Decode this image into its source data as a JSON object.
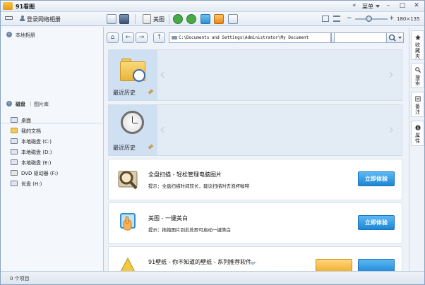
{
  "app": {
    "title": "91看图",
    "collapse_glyph": "«",
    "menu_label": "菜单",
    "window_controls": {
      "minimize": "–",
      "maximize": "□",
      "close": "✕"
    }
  },
  "toolbar": {
    "login_label": "登录网络相册",
    "beauty_label": "美图",
    "icons": [
      "usb-icon",
      "user-icon",
      "slideshow-icon",
      "screenshot-icon",
      "edit-icon",
      "rotate-left-icon",
      "rotate-right-icon",
      "delete-icon",
      "folder-icon",
      "chat-icon",
      "grid-view-icon",
      "list-view-icon"
    ],
    "zoom": {
      "minus": "−",
      "plus": "+",
      "value": "180×135",
      "level_fraction": 0.43
    }
  },
  "left_panel": {
    "album_header": "本地相册",
    "disk_header": "磁盘",
    "gallery_header": "图片库",
    "items": [
      {
        "label": "桌面",
        "icon": "desktop-icon"
      },
      {
        "label": "我的文档",
        "icon": "documents-icon"
      },
      {
        "label": "本地磁盘 (C:)",
        "icon": "disk-icon"
      },
      {
        "label": "本地磁盘 (D:)",
        "icon": "disk-icon"
      },
      {
        "label": "本地磁盘 (E:)",
        "icon": "disk-icon"
      },
      {
        "label": "DVD 驱动器 (F:)",
        "icon": "dvd-icon"
      },
      {
        "label": "优盘 (H:)",
        "icon": "usb-drive-icon"
      }
    ]
  },
  "address": {
    "home": "⌂",
    "back": "←",
    "forward": "→",
    "up": "↑",
    "path": "C:\\Documents and Settings\\Administrator\\My Document",
    "search_placeholder": ""
  },
  "content": {
    "history_cards": [
      {
        "label": "最近历史"
      },
      {
        "label": "最近历史"
      }
    ],
    "features": [
      {
        "title": "全盘扫描 - 轻松管理电脑图片",
        "tip": "提示：全盘扫描时间较长，建议扫描时去泡杯咖啡",
        "button": "立即体验"
      },
      {
        "title": "美图 - 一键美白",
        "tip": "提示：拖拽图片到此处即可启动一键美白",
        "button": "立即体验"
      },
      {
        "title": "91壁纸 - 你不知道的壁纸 - 系列推荐软件",
        "tip": "",
        "button": ""
      }
    ]
  },
  "right_tabs": [
    {
      "label": "收藏夹",
      "icon": "star-icon"
    },
    {
      "label": "搜索",
      "icon": "search-icon"
    },
    {
      "label": "备注",
      "icon": "note-icon"
    },
    {
      "label": "属性",
      "icon": "info-icon"
    }
  ],
  "status": {
    "text": "0 个项目"
  }
}
